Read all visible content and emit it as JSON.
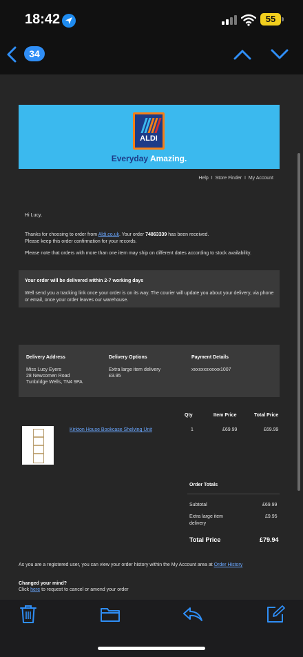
{
  "status_bar": {
    "time": "18:42",
    "battery": "55"
  },
  "nav": {
    "unread_count": "34"
  },
  "email": {
    "brand": "ALDI",
    "tagline_part1": "Everyday",
    "tagline_part2": "Amazing.",
    "top_links": [
      "Help",
      "Store Finder",
      "My Account"
    ],
    "greeting": "Hi Lucy,",
    "intro_before": "Thanks for choosing to order from ",
    "intro_link": "Aldi.co.uk",
    "intro_mid": ". Your order ",
    "order_number": "74863339",
    "intro_after": " has been received.",
    "intro_line2": "Please keep this order confirmation for your records.",
    "stock_note": "Please note that orders with more than one item may ship on different dates according to stock availability.",
    "delivery_heading": "Your order will be delivered within 2-7 working days",
    "delivery_text": "Well send you a tracking link once your order is on its way. The courier will update you about your delivery, via phone or email, once your order leaves our warehouse.",
    "address_heading": "Delivery Address",
    "address_lines": [
      "Miss Lucy Eyers",
      "28 Newcomen Road",
      "Tunbridge Wells, TN4 9PA"
    ],
    "options_heading": "Delivery Options",
    "options_lines": [
      "Extra large item delivery",
      "£9.95"
    ],
    "payment_heading": "Payment Details",
    "payment_card": "xxxxxxxxxxxx1007",
    "table_headers": {
      "qty": "Qty",
      "item_price": "Item Price",
      "total_price": "Total Price"
    },
    "product": {
      "name": "Kirkton House Bookcase Shelving Unit",
      "qty": "1",
      "item_price": "£69.99",
      "total_price": "£69.99"
    },
    "totals_heading": "Order Totals",
    "subtotal_label": "Subtotal",
    "subtotal_value": "£69.99",
    "delivery_label_line1": "Extra large item",
    "delivery_label_line2": "delivery",
    "delivery_value": "£9.95",
    "total_label": "Total Price",
    "total_value": "£79.94",
    "history_text": "As you are a registered user, you can view your order history within the My Account area at ",
    "history_link": "Order History",
    "changed_heading": "Changed your mind?",
    "changed_before": "Click ",
    "changed_link": "here",
    "changed_after": " to request to cancel or amend your order"
  },
  "colors": {
    "accent": "#2f8ef6",
    "aldi_blue": "#3bb9ee",
    "aldi_navy": "#1d3b88",
    "aldi_orange": "#f57f17",
    "battery": "#f2cf1e"
  }
}
